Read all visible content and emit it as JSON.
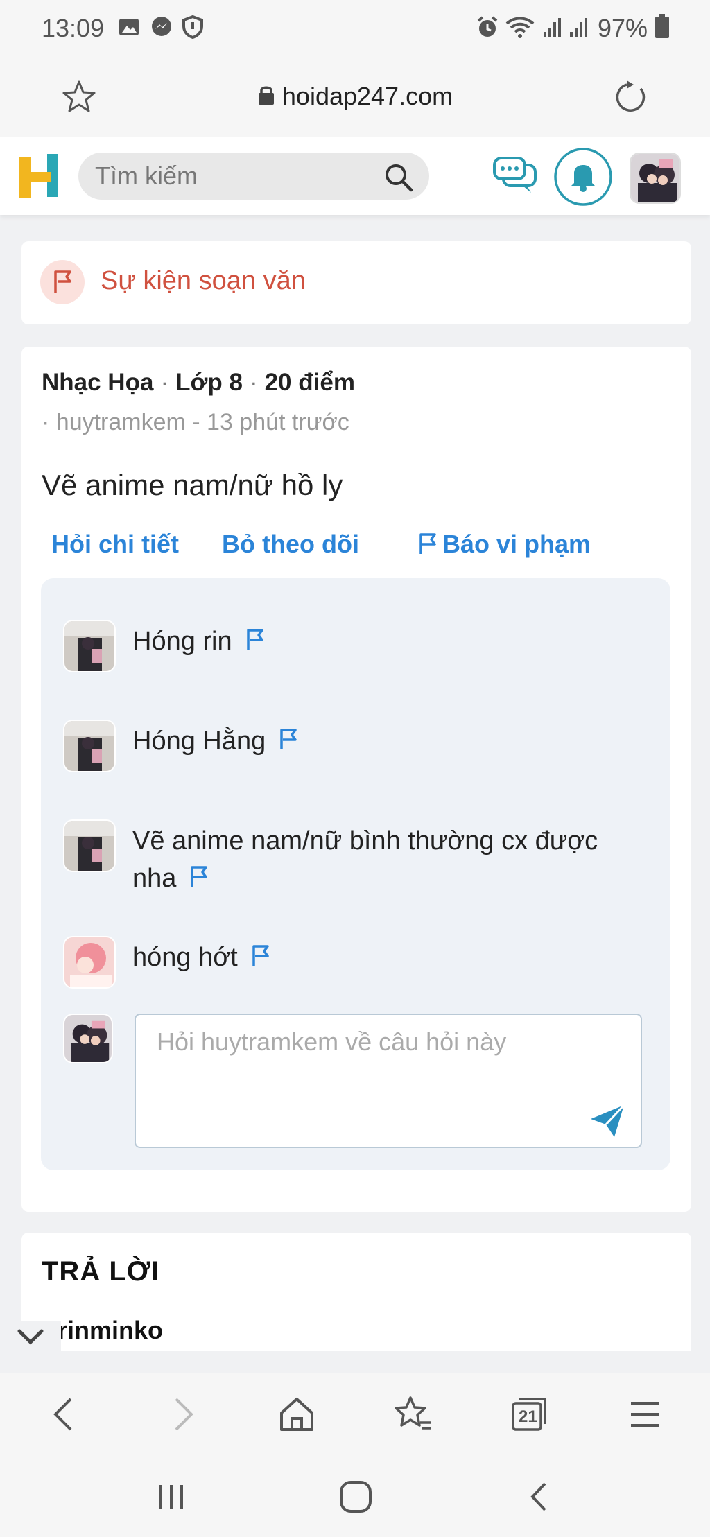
{
  "status_bar": {
    "time": "13:09",
    "battery": "97%",
    "icons": [
      "image-icon",
      "messenger-icon",
      "shield-icon",
      "alarm-icon",
      "wifi-icon",
      "signal-icon",
      "battery-icon"
    ]
  },
  "browser": {
    "url": "hoidap247.com",
    "icons": [
      "star-icon",
      "lock-icon",
      "reload-icon"
    ],
    "tab_count": "21",
    "bottom_icons": [
      "back-icon",
      "forward-icon",
      "home-icon",
      "bookmarks-icon",
      "tabs-icon",
      "menu-icon"
    ],
    "system_icons": [
      "recents-icon",
      "home-icon",
      "back-icon"
    ]
  },
  "site_header": {
    "logo": "H",
    "search_placeholder": "Tìm kiếm",
    "icons": [
      "chat-icon",
      "bell-icon",
      "avatar"
    ]
  },
  "event": {
    "label": "Sự kiện soạn văn"
  },
  "question": {
    "subject": "Nhạc Họa",
    "grade": "Lớp 8",
    "points": "20 điểm",
    "author_prefix": "·",
    "author": "huytramkem - 13 phút trước",
    "text": "Vẽ anime nam/nữ hồ ly",
    "actions": {
      "detail": "Hỏi chi tiết",
      "unfollow": "Bỏ theo dõi",
      "report": "Báo vi phạm"
    }
  },
  "comments": [
    {
      "text": "Hóng rin"
    },
    {
      "text": "Hóng Hằng"
    },
    {
      "text": "Vẽ anime nam/nữ bình thường cx được nha"
    },
    {
      "text": "hóng hớt"
    }
  ],
  "reply_placeholder": "Hỏi huytramkem về câu hỏi này",
  "answers": {
    "title": "TRẢ LỜI",
    "first_user": "rinminko"
  },
  "colors": {
    "brand_blue": "#2b84d8",
    "event_red": "#d0513f",
    "logo_yellow": "#f2b61f",
    "logo_teal": "#2aa7b5"
  }
}
